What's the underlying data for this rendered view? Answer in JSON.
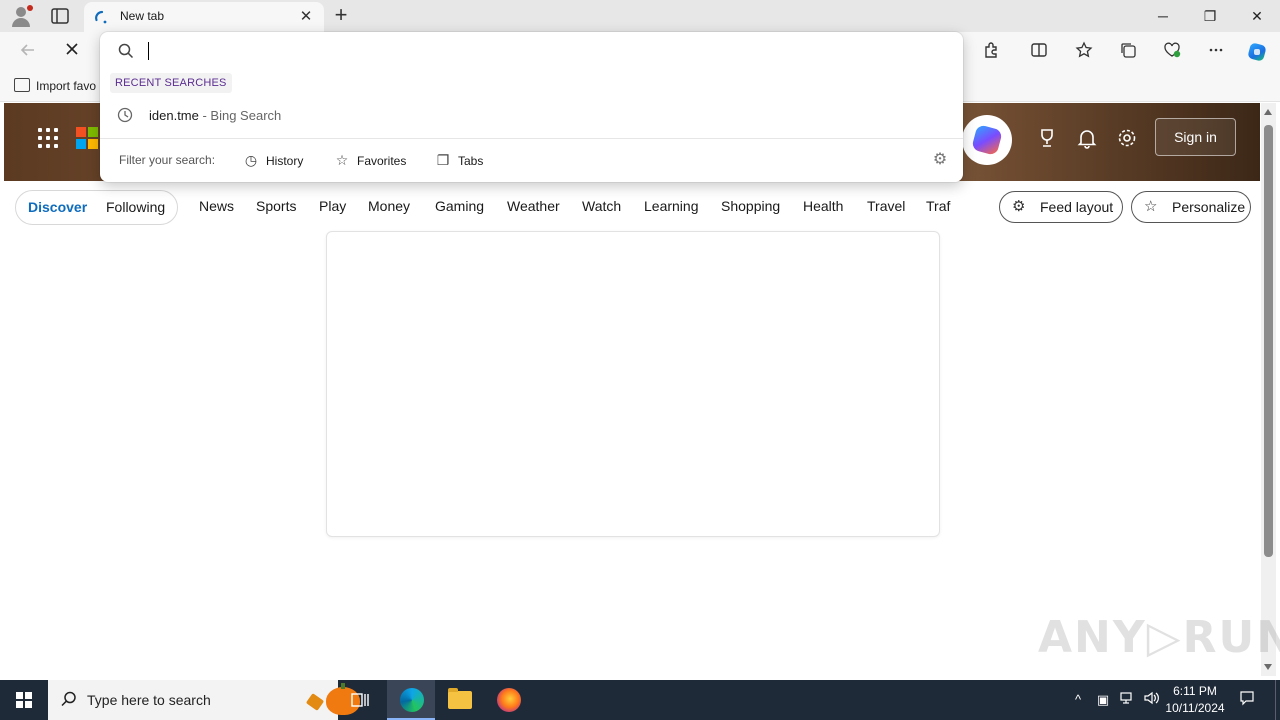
{
  "browser": {
    "tab": {
      "title": "New tab",
      "close": "✕"
    },
    "new_tab": "+",
    "window_controls": {
      "minimize": "─",
      "restore": "❐",
      "close": "✕"
    },
    "toolbar_icons": [
      "back-arrow",
      "stop-loading",
      "extensions",
      "split-screen",
      "favorites",
      "collections",
      "browser-essentials",
      "more",
      "copilot"
    ],
    "favorites_bar": {
      "import_label": "Import favo"
    }
  },
  "omnibox": {
    "value": "",
    "recent_header": "RECENT SEARCHES",
    "suggestions": [
      {
        "query": "iden.tme",
        "source": " - Bing Search"
      }
    ],
    "filter_label": "Filter your search:",
    "filters": [
      {
        "label": "History",
        "icon": "history-icon"
      },
      {
        "label": "Favorites",
        "icon": "star-icon"
      },
      {
        "label": "Tabs",
        "icon": "tabs-icon"
      }
    ]
  },
  "page": {
    "sign_in": "Sign in",
    "feed_tabs": {
      "discover": "Discover",
      "following": "Following"
    },
    "categories": [
      "News",
      "Sports",
      "Play",
      "Money",
      "Gaming",
      "Weather",
      "Watch",
      "Learning",
      "Shopping",
      "Health",
      "Travel",
      "Traf"
    ],
    "feed_layout": "Feed layout",
    "personalize": "Personalize"
  },
  "taskbar": {
    "search_placeholder": "Type here to search",
    "time": "6:11 PM",
    "date": "10/11/2024"
  },
  "watermark": "ANY▷RUN",
  "colors": {
    "accent_blue": "#0f6cbd",
    "recent_header": "#5c2d91",
    "taskbar": "#1f2a38"
  }
}
